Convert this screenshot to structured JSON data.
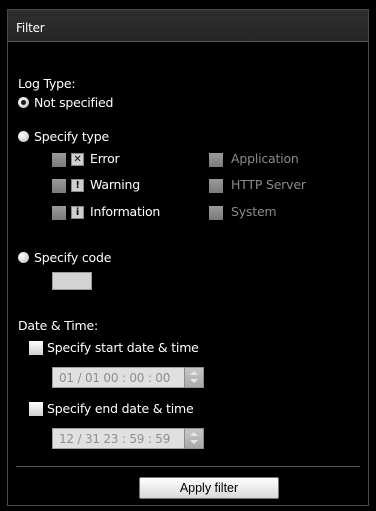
{
  "header": {
    "title": "Filter"
  },
  "log_type": {
    "label": "Log Type:",
    "not_specified": "Not specified",
    "specify_type": "Specify type",
    "types": {
      "error": "Error",
      "warning": "Warning",
      "information": "Information",
      "application": "Application",
      "http_server": "HTTP Server",
      "system": "System"
    },
    "specify_code": "Specify code",
    "code_value": ""
  },
  "date_time": {
    "label": "Date & Time:",
    "specify_start": "Specify start date & time",
    "start_value": "01 / 01 00 : 00 : 00",
    "specify_end": "Specify end date & time",
    "end_value": "12 / 31 23 : 59 : 59"
  },
  "apply_button": "Apply filter"
}
